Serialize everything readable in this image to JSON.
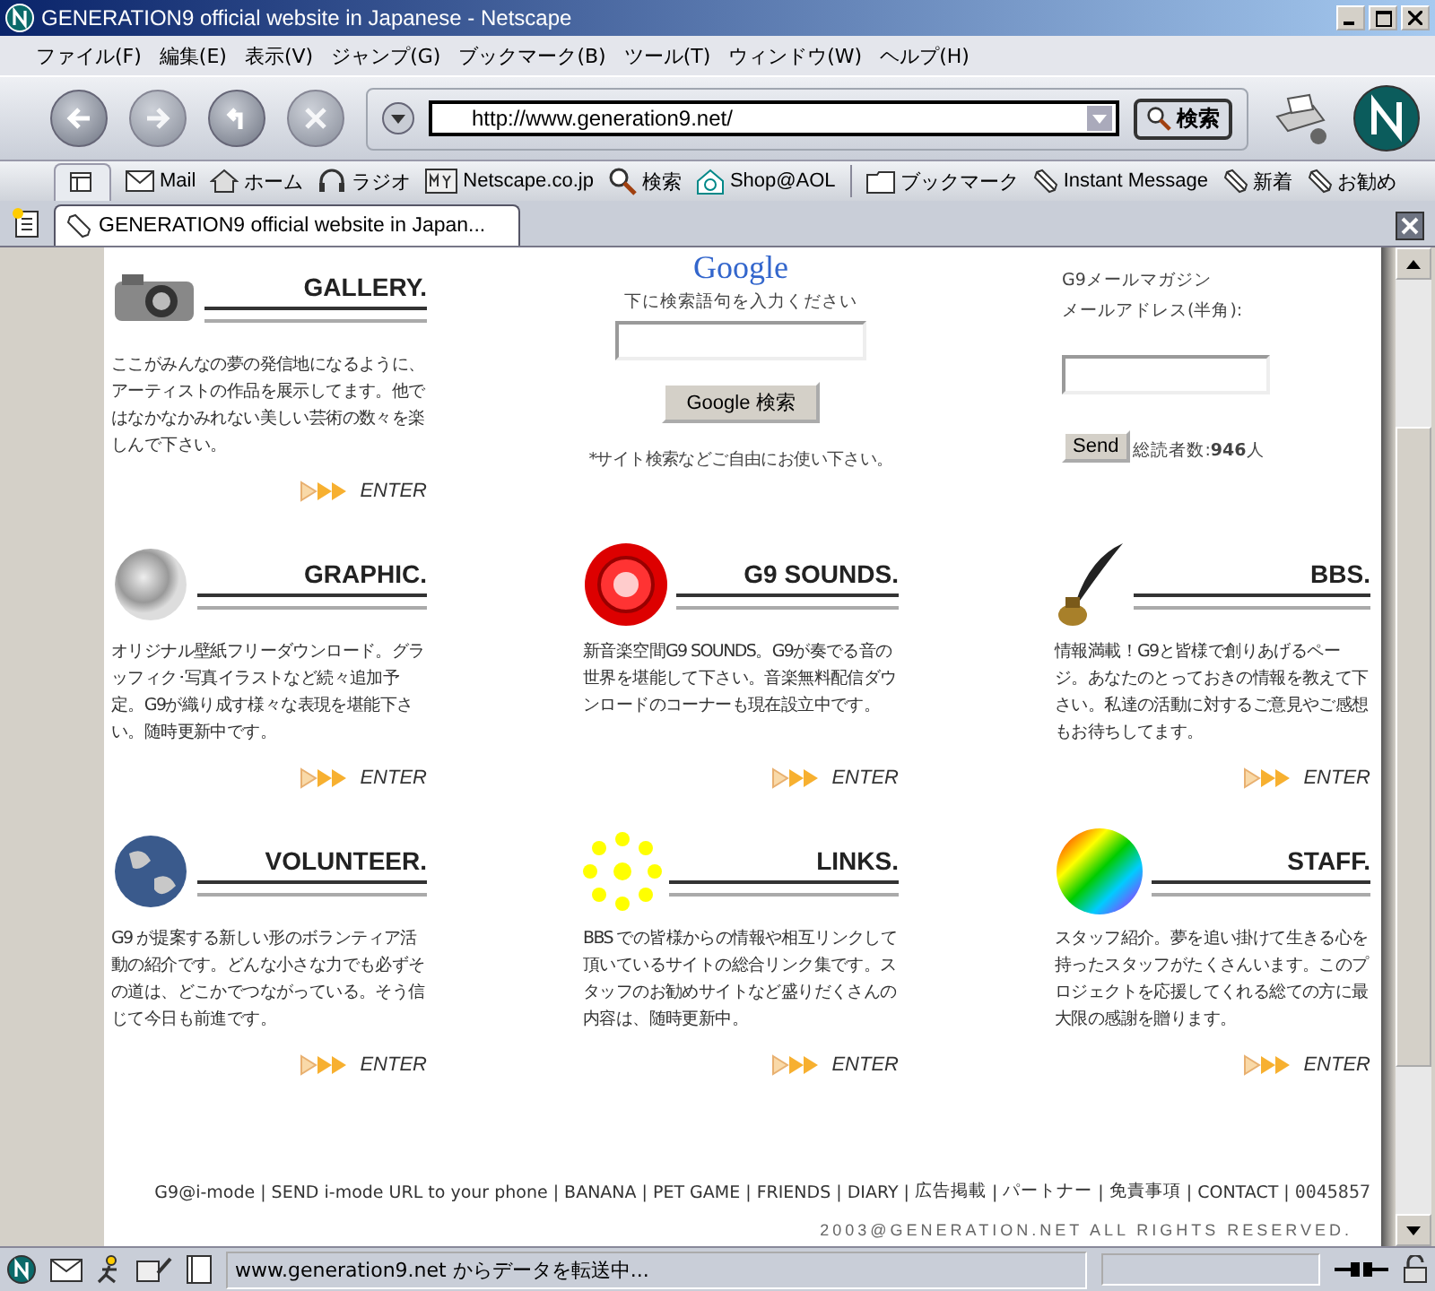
{
  "window": {
    "title": "GENERATION9 official website in Japanese - Netscape"
  },
  "menu": [
    "ファイル(F)",
    "編集(E)",
    "表示(V)",
    "ジャンプ(G)",
    "ブックマーク(B)",
    "ツール(T)",
    "ウィンドウ(W)",
    "ヘルプ(H)"
  ],
  "navigation": {
    "url": "http://www.generation9.net/",
    "search_button": "検索"
  },
  "personal_toolbar": [
    {
      "kind": "mail",
      "label": "Mail"
    },
    {
      "kind": "home",
      "label": "ホーム"
    },
    {
      "kind": "radio",
      "label": "ラジオ"
    },
    {
      "kind": "my",
      "label": "Netscape.co.jp"
    },
    {
      "kind": "search",
      "label": "検索"
    },
    {
      "kind": "shop",
      "label": "Shop@AOL"
    },
    {
      "kind": "folder",
      "label": "ブックマーク"
    },
    {
      "kind": "bookmark",
      "label": "Instant Message"
    },
    {
      "kind": "bookmark",
      "label": "新着"
    },
    {
      "kind": "bookmark",
      "label": "お勧め"
    }
  ],
  "tab": {
    "title": "GENERATION9 official website in Japan..."
  },
  "page": {
    "gallery": {
      "kind": "camera",
      "title": "GALLERY.",
      "text": "ここがみんなの夢の発信地になるように、アーティストの作品を展示してます。他ではなかなかみれない美しい芸術の数々を楽しんで下さい。",
      "enter": "ENTER"
    },
    "search": {
      "logo": "Google",
      "caption": "下に検索語句を入力ください",
      "button": "Google 検索",
      "note": "*サイト検索などご自由にお使い下さい。"
    },
    "newsletter": {
      "title": "G9メールマガジン",
      "label": "メールアドレス(半角):",
      "button": "Send",
      "count": "総読者数:**946**人"
    },
    "sections": [
      {
        "kind": "sphere",
        "title": "GRAPHIC.",
        "text": "オリジナル壁紙フリーダウンロード。グラッフィク･写真イラストなど続々追加予定。G9が織り成す様々な表現を堪能下さい。随時更新中です。",
        "enter": "ENTER"
      },
      {
        "kind": "disc",
        "title": "G9 SOUNDS.",
        "text": "新音楽空間G9 SOUNDS。G9が奏でる音の世界を堪能して下さい。音楽無料配信ダウンロードのコーナーも現在設立中です。",
        "enter": "ENTER"
      },
      {
        "kind": "quill",
        "title": "BBS.",
        "text": "情報満載！G9と皆様で創りあげるページ。あなたのとっておきの情報を教えて下さい。私達の活動に対するご意見やご感想もお待ちしてます。",
        "enter": "ENTER"
      },
      {
        "kind": "globe",
        "title": "VOLUNTEER.",
        "text": "G9 が提案する新しい形のボランティア活動の紹介です。どんな小さな力でも必ずその道は、どこかでつながっている。そう信じて今日も前進です。",
        "enter": "ENTER"
      },
      {
        "kind": "dots",
        "title": "LINKS.",
        "text": "BBS での皆様からの情報や相互リンクして頂いているサイトの総合リンク集です。スタッフのお勧めサイトなど盛りだくさんの内容は、随時更新中。",
        "enter": "ENTER"
      },
      {
        "kind": "rainbow",
        "title": "STAFF.",
        "text": "スタッフ紹介。夢を追い掛けて生きる心を持ったスタッフがたくさんいます。このプロジェクトを応援してくれる総ての方に最大限の感謝を贈ります。",
        "enter": "ENTER"
      }
    ],
    "footer": {
      "items": [
        {
          "kind": "link",
          "text": "G9@i-mode"
        },
        {
          "kind": "separator",
          "text": "|"
        },
        {
          "kind": "link",
          "text": "SEND i-mode URL to your phone"
        },
        {
          "kind": "separator",
          "text": "|"
        },
        {
          "kind": "link",
          "text": "BANANA"
        },
        {
          "kind": "separator",
          "text": "|"
        },
        {
          "kind": "link",
          "text": "PET GAME"
        },
        {
          "kind": "separator",
          "text": "|"
        },
        {
          "kind": "link",
          "text": "FRIENDS"
        },
        {
          "kind": "separator",
          "text": "|"
        },
        {
          "kind": "link",
          "text": "DIARY"
        },
        {
          "kind": "separator",
          "text": "|"
        },
        {
          "kind": "link",
          "text": "広告掲載"
        },
        {
          "kind": "separator",
          "text": "|"
        },
        {
          "kind": "link",
          "text": "パートナー"
        },
        {
          "kind": "separator",
          "text": "|"
        },
        {
          "kind": "link",
          "text": "免責事項"
        },
        {
          "kind": "separator",
          "text": "|"
        },
        {
          "kind": "link",
          "text": "CONTACT"
        },
        {
          "kind": "separator",
          "text": "|"
        },
        {
          "kind": "counter",
          "text": "0045857"
        }
      ],
      "copyright": "2003@GENERATION.NET ALL RIGHTS RESERVED."
    }
  },
  "status_bar": {
    "text": "www.generation9.net からデータを転送中..."
  }
}
